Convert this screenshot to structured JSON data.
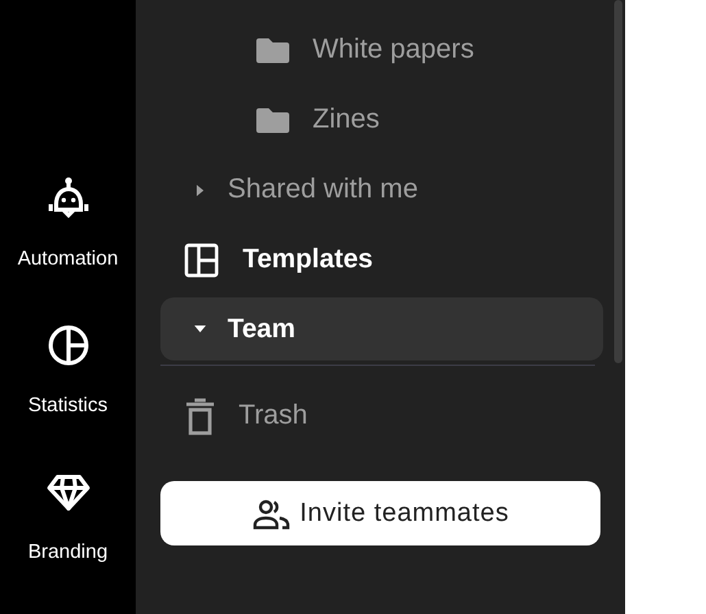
{
  "rail": [
    {
      "kind": "automation",
      "label": "Automation"
    },
    {
      "kind": "statistics",
      "label": "Statistics"
    },
    {
      "kind": "branding",
      "label": "Branding"
    }
  ],
  "nav": [
    {
      "kind": "folder",
      "label": "White papers",
      "selected": false
    },
    {
      "kind": "folder",
      "label": "Zines",
      "selected": false
    },
    {
      "kind": "group",
      "label": "Shared with me",
      "expanded": false,
      "selected": false
    },
    {
      "kind": "templates",
      "label": "Templates",
      "selected": false
    },
    {
      "kind": "group",
      "label": "Team",
      "expanded": true,
      "selected": true
    },
    {
      "kind": "trash",
      "label": "Trash",
      "selected": false
    }
  ],
  "invite_button": {
    "label": "Invite teammates"
  }
}
